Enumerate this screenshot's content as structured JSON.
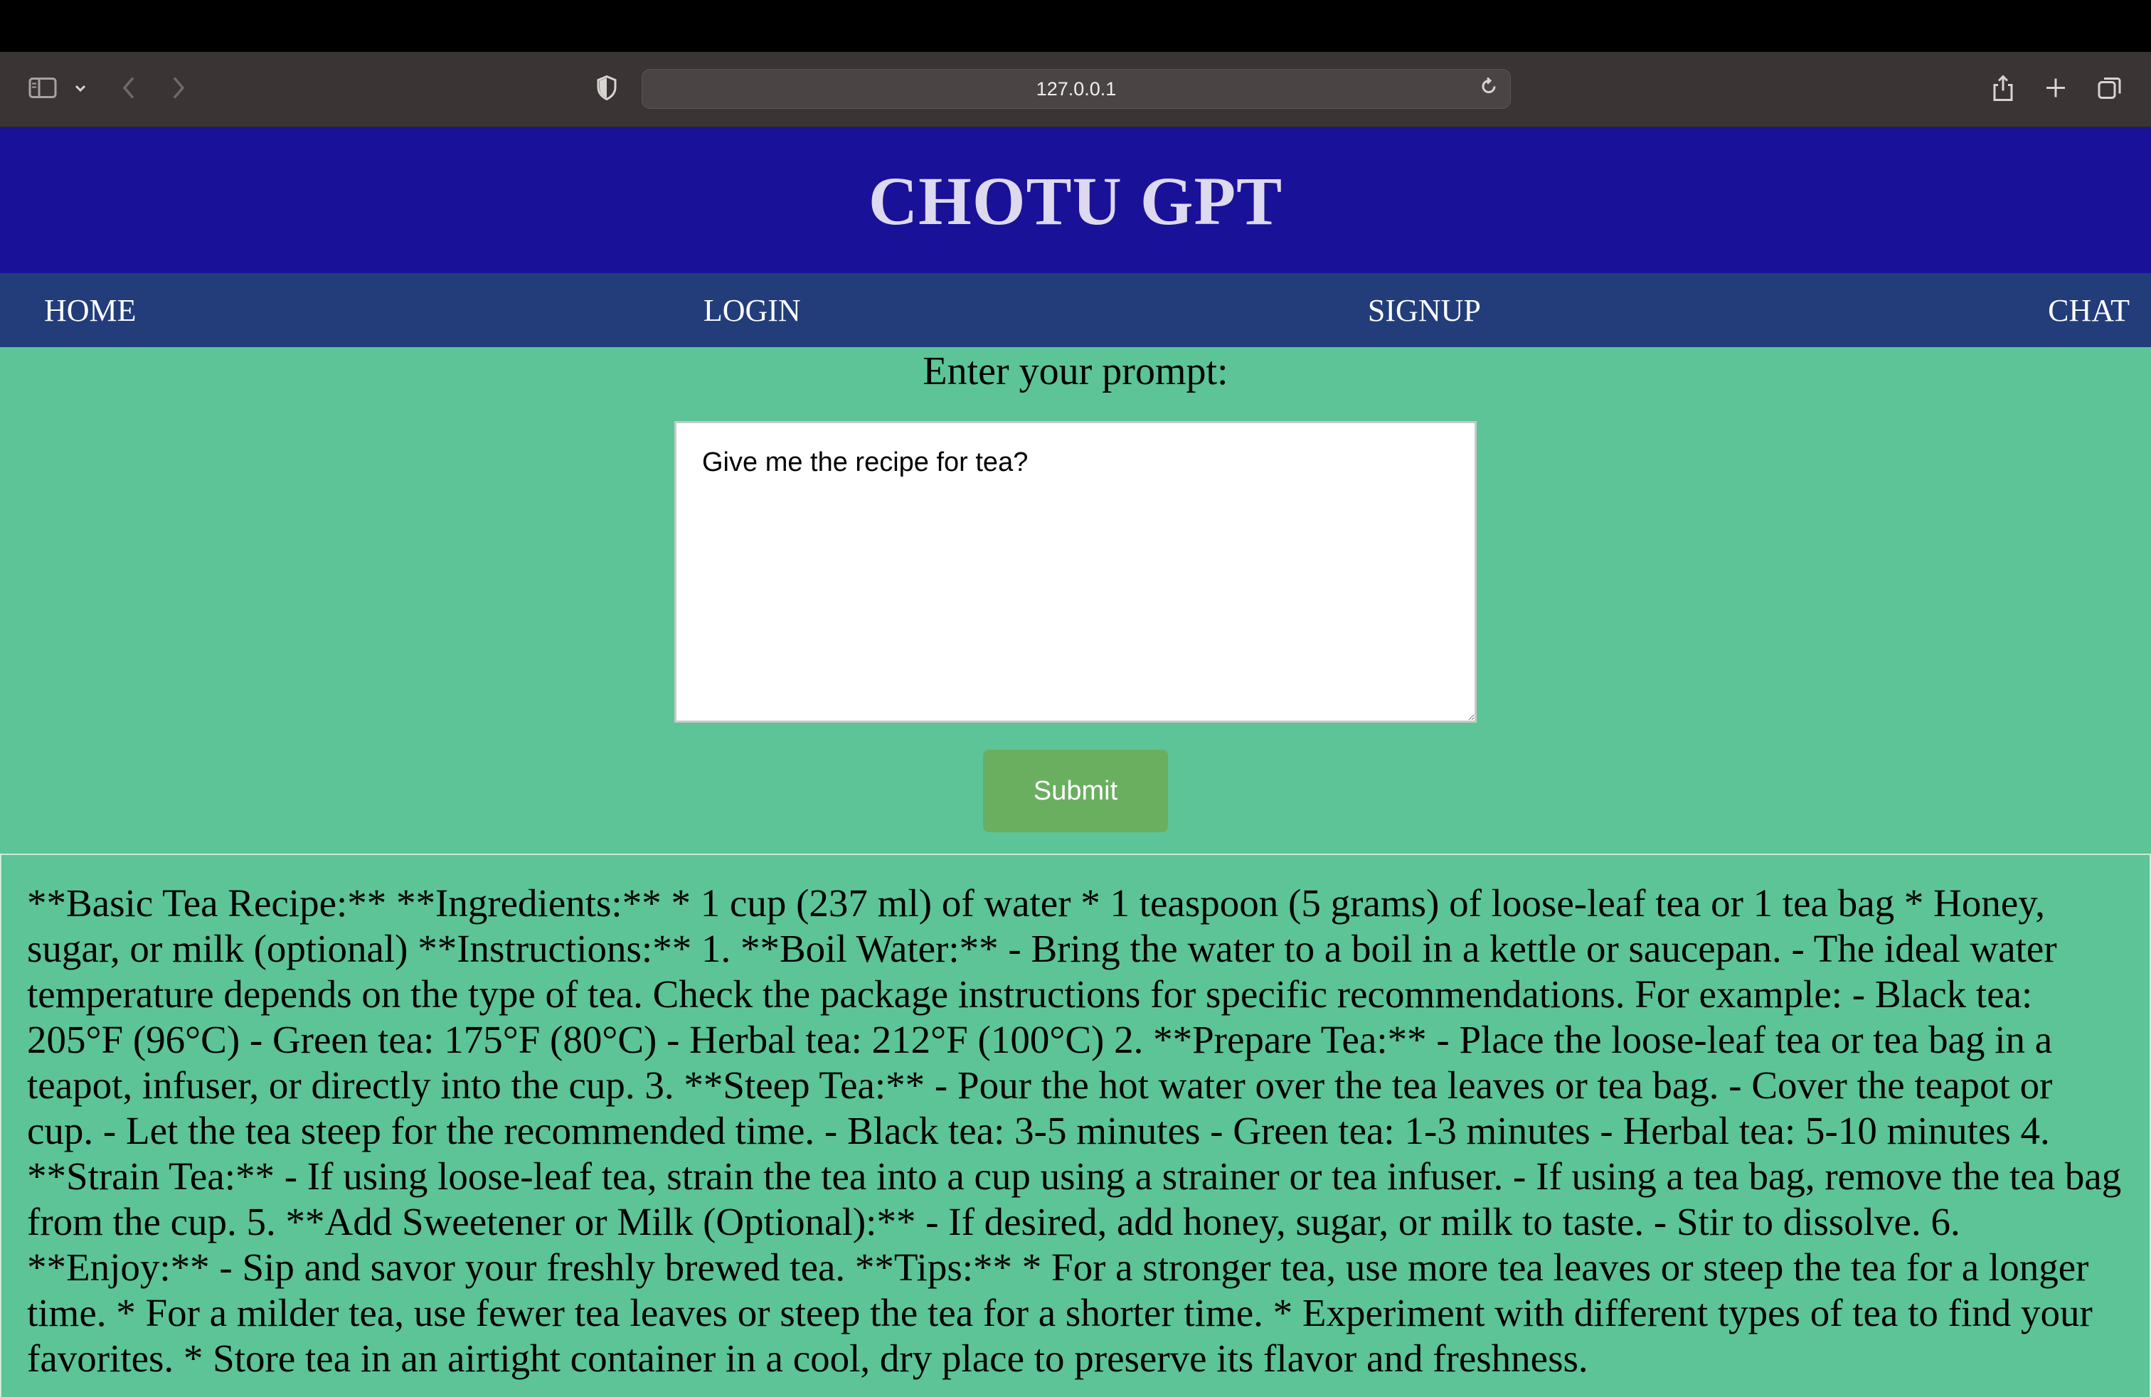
{
  "browser": {
    "url": "127.0.0.1",
    "icons": [
      "sidebar-icon",
      "chevron-down-icon",
      "back-icon",
      "forward-icon",
      "shield-icon",
      "reload-icon",
      "share-icon",
      "new-tab-icon",
      "tabs-overview-icon"
    ]
  },
  "header": {
    "title": "CHOTU GPT"
  },
  "nav": {
    "home": "HOME",
    "login": "LOGIN",
    "signup": "SIGNUP",
    "chat": "CHAT"
  },
  "form": {
    "label": "Enter your prompt:",
    "prompt_value": "Give me the recipe for tea?",
    "submit_label": "Submit"
  },
  "response": {
    "text": "**Basic Tea Recipe:** **Ingredients:** * 1 cup (237 ml) of water * 1 teaspoon (5 grams) of loose-leaf tea or 1 tea bag * Honey, sugar, or milk (optional) **Instructions:** 1. **Boil Water:** - Bring the water to a boil in a kettle or saucepan. - The ideal water temperature depends on the type of tea. Check the package instructions for specific recommendations. For example: - Black tea: 205°F (96°C) - Green tea: 175°F (80°C) - Herbal tea: 212°F (100°C) 2. **Prepare Tea:** - Place the loose-leaf tea or tea bag in a teapot, infuser, or directly into the cup. 3. **Steep Tea:** - Pour the hot water over the tea leaves or tea bag. - Cover the teapot or cup. - Let the tea steep for the recommended time. - Black tea: 3-5 minutes - Green tea: 1-3 minutes - Herbal tea: 5-10 minutes 4. **Strain Tea:** - If using loose-leaf tea, strain the tea into a cup using a strainer or tea infuser. - If using a tea bag, remove the tea bag from the cup. 5. **Add Sweetener or Milk (Optional):** - If desired, add honey, sugar, or milk to taste. - Stir to dissolve. 6. **Enjoy:** - Sip and savor your freshly brewed tea. **Tips:** * For a stronger tea, use more tea leaves or steep the tea for a longer time. * For a milder tea, use fewer tea leaves or steep the tea for a shorter time. * Experiment with different types of tea to find your favorites. * Store tea in an airtight container in a cool, dry place to preserve its flavor and freshness."
  },
  "colors": {
    "header_bg": "#1a1199",
    "nav_bg": "#223d7a",
    "page_bg": "#5cc497",
    "button_bg": "#6aaf60"
  }
}
